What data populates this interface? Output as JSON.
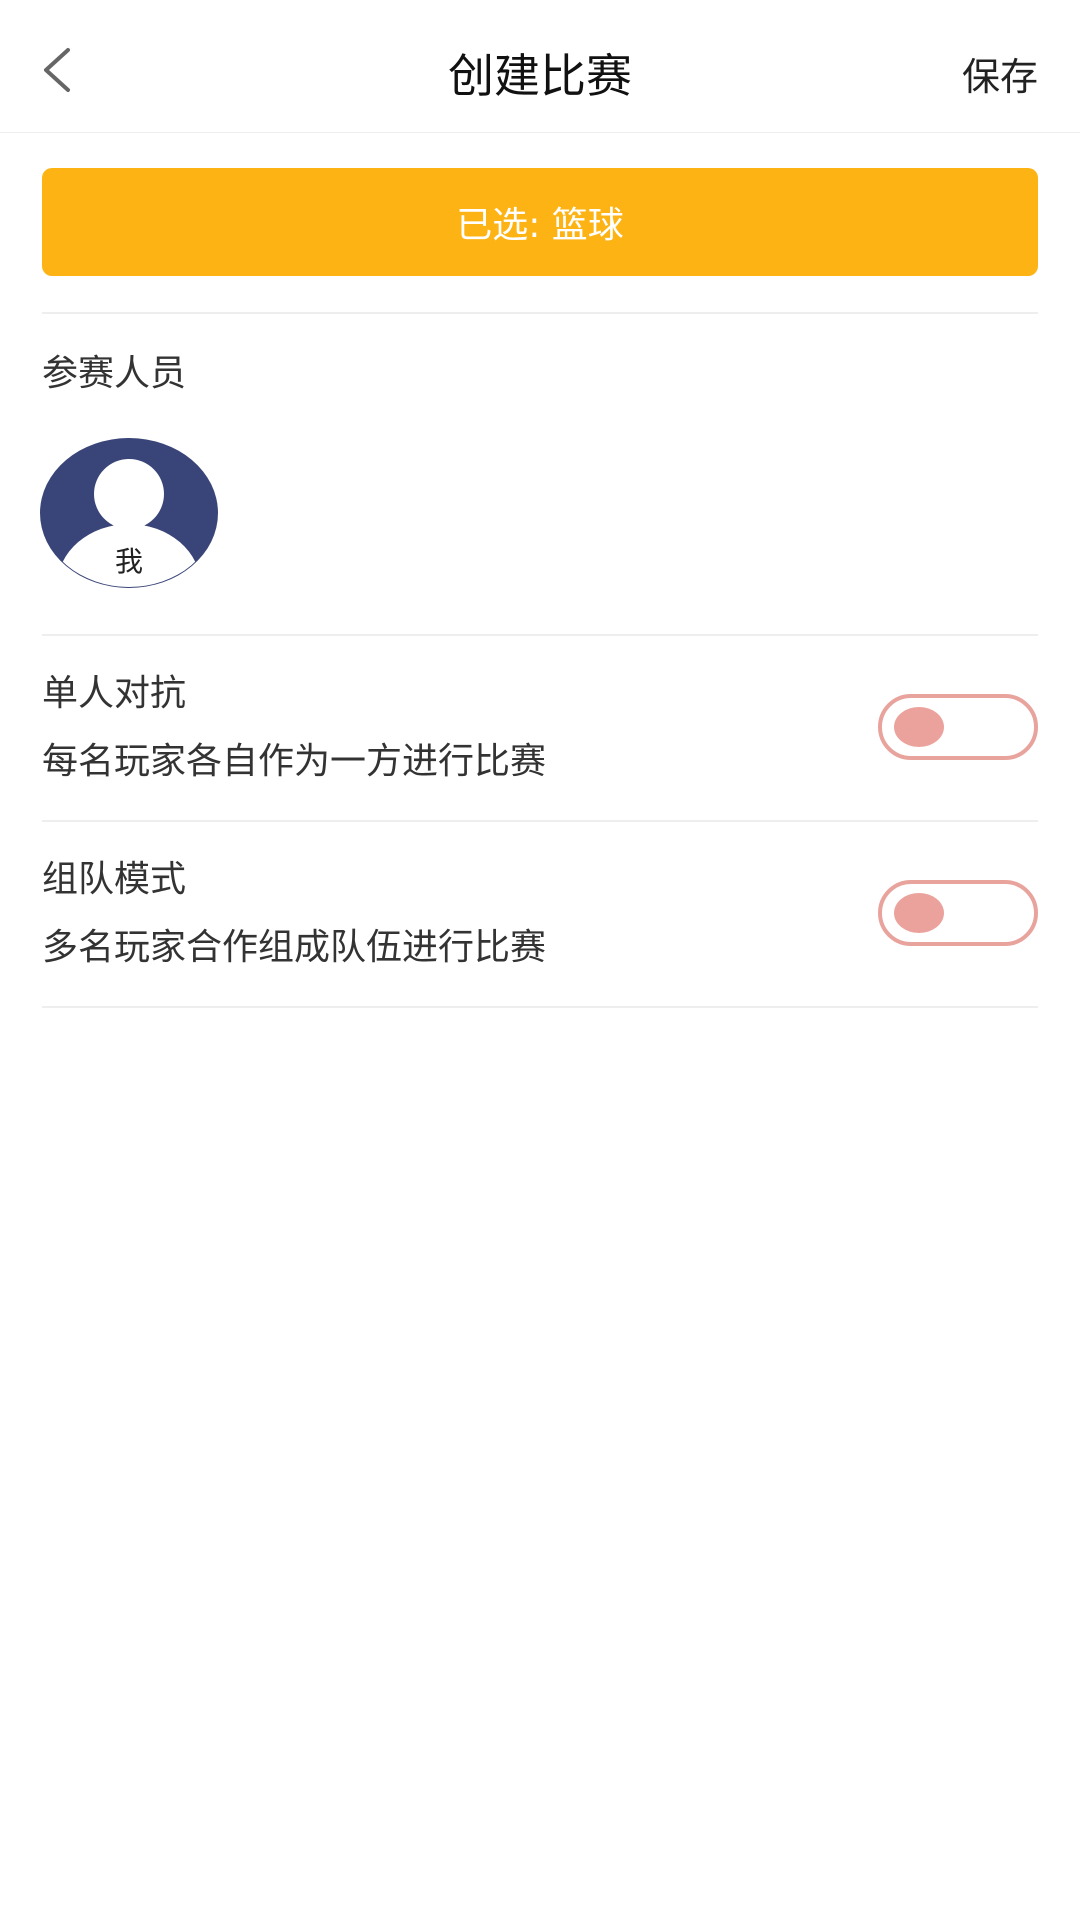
{
  "header": {
    "title": "创建比赛",
    "save_label": "保存",
    "back_icon": "chevron-left-icon"
  },
  "banner": {
    "text": "已选: 篮球",
    "color": "#fdb314"
  },
  "participants": {
    "label": "参赛人员",
    "members": [
      {
        "name": "我",
        "icon": "user-avatar-icon",
        "color": "#394478"
      }
    ]
  },
  "modes": [
    {
      "title": "单人对抗",
      "description": "每名玩家各自作为一方进行比赛",
      "enabled": false
    },
    {
      "title": "组队模式",
      "description": "多名玩家合作组成队伍进行比赛",
      "enabled": false
    }
  ],
  "colors": {
    "toggle_border": "#e8a39d",
    "toggle_knob": "#eba29c"
  }
}
